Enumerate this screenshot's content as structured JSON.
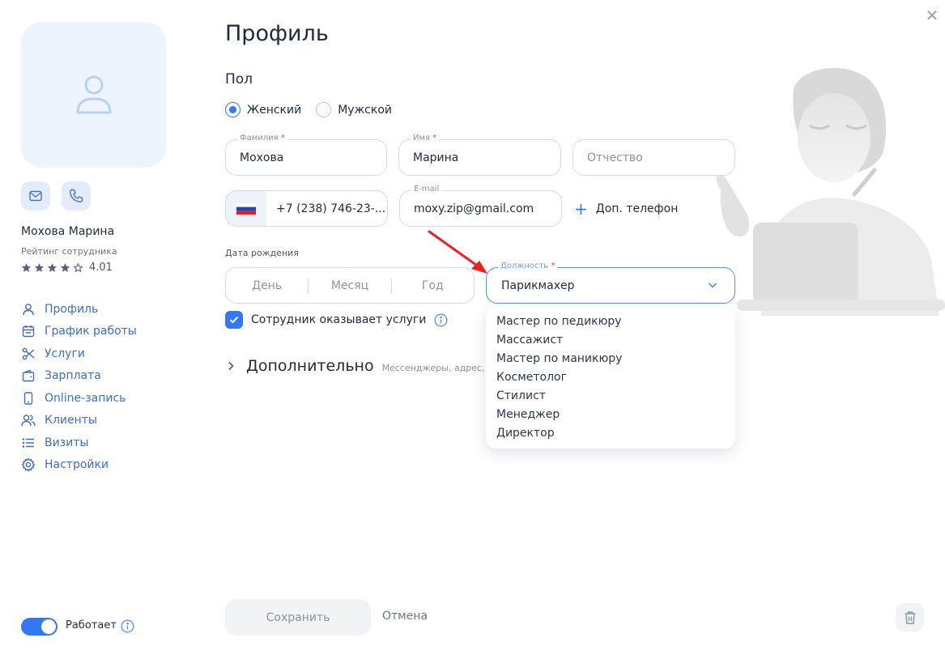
{
  "profile": {
    "name": "Мохова Марина",
    "rating_label": "Рейтинг сотрудника",
    "rating_value": "4.01",
    "rating_stars": 4
  },
  "nav": {
    "items": [
      {
        "label": "Профиль",
        "icon": "user-icon"
      },
      {
        "label": "График работы",
        "icon": "calendar-icon"
      },
      {
        "label": "Услуги",
        "icon": "scissors-icon"
      },
      {
        "label": "Зарплата",
        "icon": "wallet-icon"
      },
      {
        "label": "Online-запись",
        "icon": "phone-device-icon"
      },
      {
        "label": "Клиенты",
        "icon": "users-icon"
      },
      {
        "label": "Визиты",
        "icon": "list-icon"
      },
      {
        "label": "Настройки",
        "icon": "gear-icon"
      }
    ]
  },
  "status": {
    "label": "Работает",
    "enabled": true
  },
  "main": {
    "title": "Профиль",
    "gender_section": "Пол",
    "gender_options": [
      "Женский",
      "Мужской"
    ],
    "gender_selected": "Женский"
  },
  "form": {
    "last_name": {
      "label": "Фамилия",
      "value": "Мохова"
    },
    "first_name": {
      "label": "Имя",
      "value": "Марина"
    },
    "patronymic": {
      "placeholder": "Отчество"
    },
    "phone": {
      "value": "+7 (238) 746-23-..."
    },
    "email": {
      "label": "E-mail",
      "value": "moxy.zip@gmail.com"
    },
    "add_phone": "Доп. телефон",
    "dob_label": "Дата рождения",
    "dob_day": "День",
    "dob_month": "Месяц",
    "dob_year": "Год",
    "position": {
      "label": "Должность",
      "value": "Парикмахер"
    },
    "position_options": [
      "Мастер по педикюру",
      "Массажист",
      "Мастер по маникюру",
      "Косметолог",
      "Стилист",
      "Менеджер",
      "Директор"
    ],
    "provides_services": "Сотрудник оказывает услуги",
    "additional_title": "Дополнительно",
    "additional_subtitle": "Мессенджеры, адрес, д"
  },
  "footer": {
    "save": "Сохранить",
    "cancel": "Отмена"
  },
  "colors": {
    "accent": "#3478f6",
    "annotation_arrow": "#e8231f",
    "nav_text": "#3d6ec2"
  }
}
